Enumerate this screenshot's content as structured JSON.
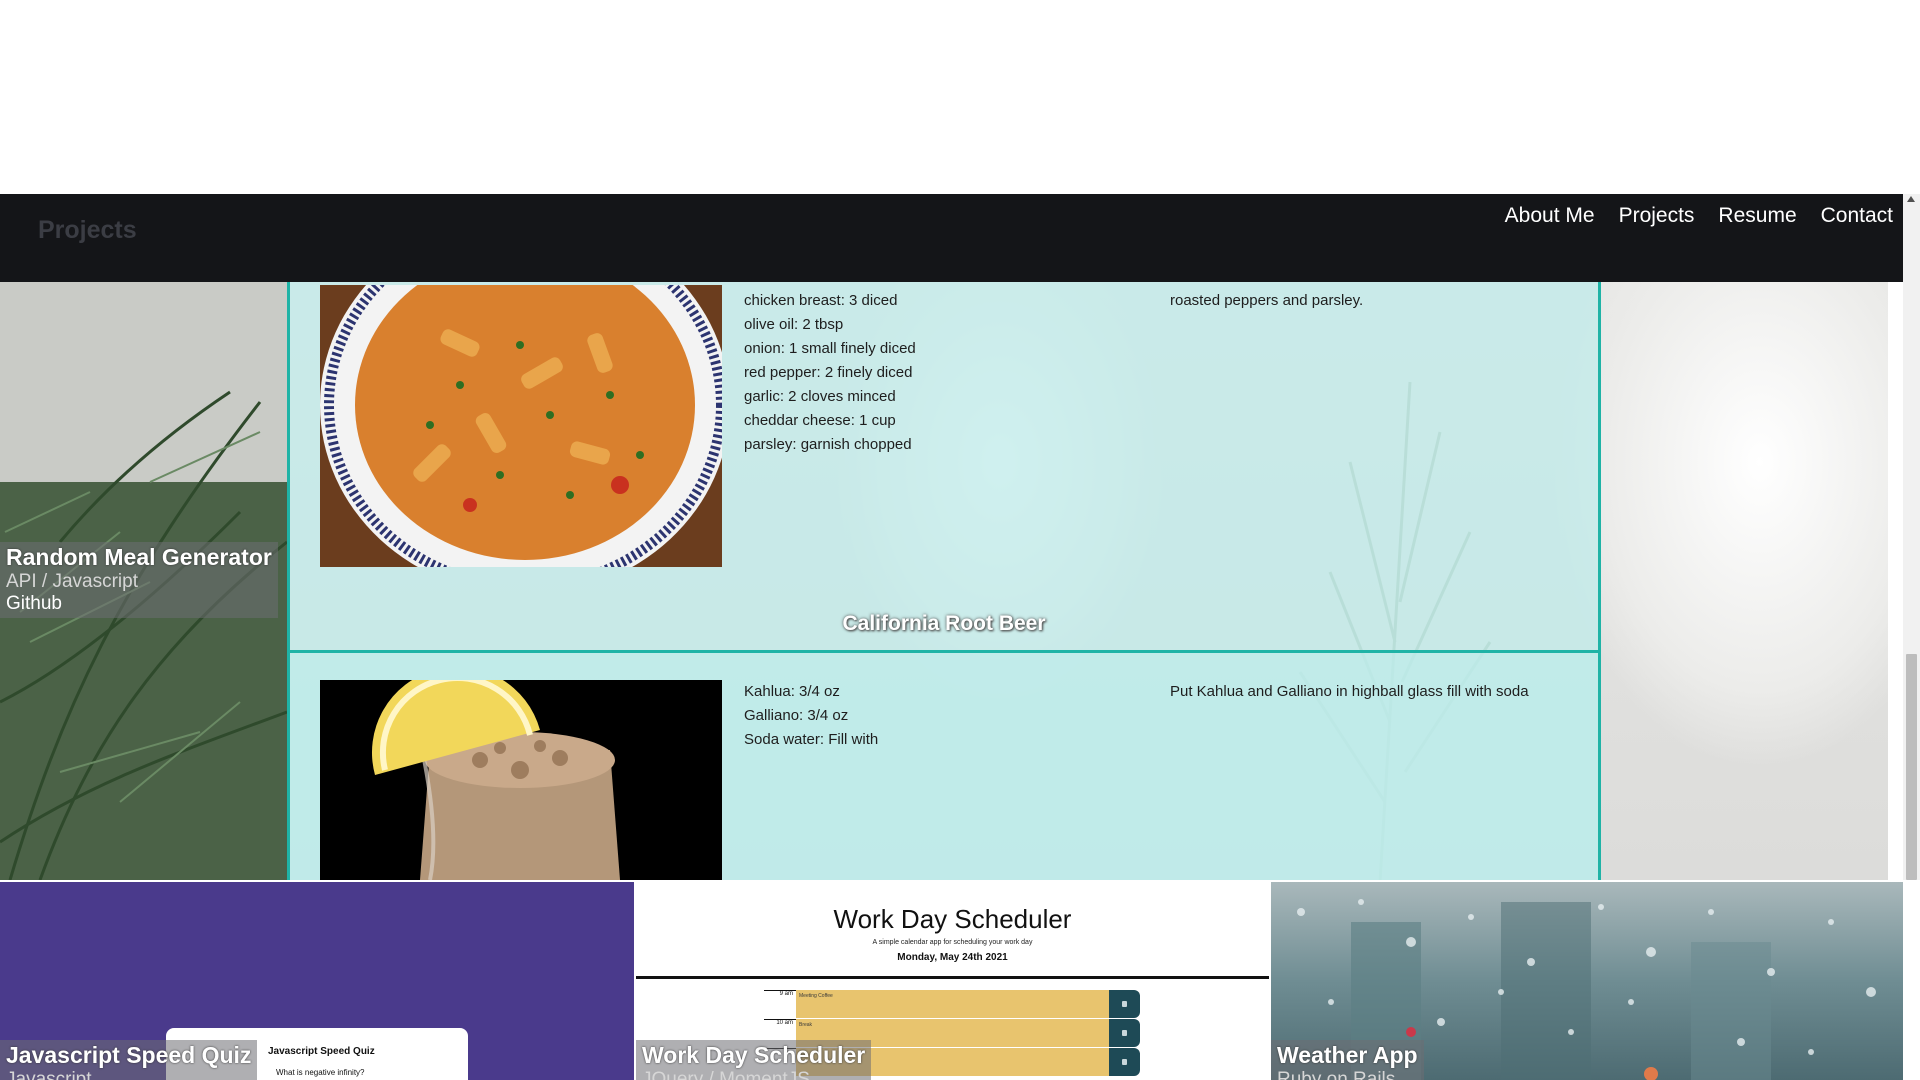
{
  "nav": {
    "title": "Projects",
    "links": [
      "About Me",
      "Projects",
      "Resume",
      "Contact"
    ]
  },
  "featured": {
    "title": "Random Meal Generator",
    "tech": "API / Javascript",
    "link": "Github"
  },
  "recipes": [
    {
      "ingredients": [
        "chicken breast: 3 diced",
        "olive oil: 2 tbsp",
        "onion: 1 small finely diced",
        "red pepper: 2 finely diced",
        "garlic: 2 cloves minced",
        "cheddar cheese: 1 cup",
        "parsley: garnish chopped"
      ],
      "instructions": "roasted peppers and parsley."
    },
    {
      "name": "California Root Beer",
      "ingredients": [
        "Kahlua: 3/4 oz",
        "Galliano: 3/4 oz",
        "Soda water: Fill with"
      ],
      "instructions": "Put Kahlua and Galliano in highball glass fill with soda"
    }
  ],
  "tiles": [
    {
      "title": "Javascript Speed Quiz",
      "tech": "Javascript",
      "preview": {
        "title": "Javascript Speed Quiz",
        "question": "What is negative infinity?"
      }
    },
    {
      "title": "Work Day Scheduler",
      "tech": "JQuery / MomentJS",
      "preview": {
        "title": "Work Day Scheduler",
        "subtitle": "A simple calendar app for scheduling your work day",
        "date": "Monday, May 24th 2021",
        "rows": [
          {
            "hour": "9 am",
            "event": "Meeting Coffee"
          },
          {
            "hour": "10 am",
            "event": "Break"
          },
          {
            "hour": "",
            "event": ""
          }
        ]
      }
    },
    {
      "title": "Weather App",
      "tech": "Ruby on Rails"
    }
  ]
}
